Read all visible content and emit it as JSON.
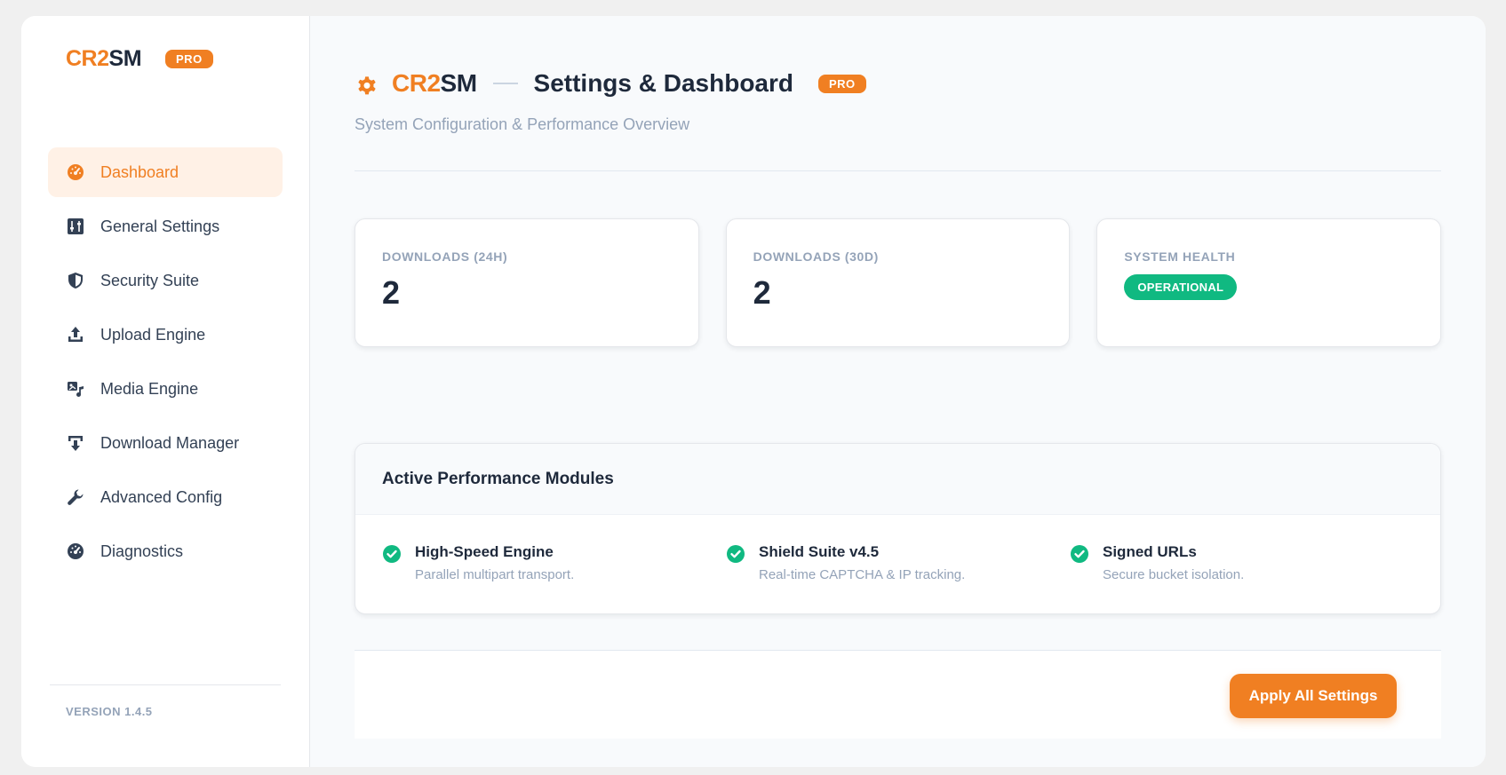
{
  "brand": {
    "name_accent": "CR2",
    "name_rest": "SM",
    "pro_label": "PRO",
    "accent_color": "#f07f22"
  },
  "sidebar": {
    "items": [
      {
        "label": "Dashboard",
        "icon": "gauge-icon",
        "active": true
      },
      {
        "label": "General Settings",
        "icon": "sliders-icon",
        "active": false
      },
      {
        "label": "Security Suite",
        "icon": "shield-icon",
        "active": false
      },
      {
        "label": "Upload Engine",
        "icon": "upload-icon",
        "active": false
      },
      {
        "label": "Media Engine",
        "icon": "media-icon",
        "active": false
      },
      {
        "label": "Download Manager",
        "icon": "download-icon",
        "active": false
      },
      {
        "label": "Advanced Config",
        "icon": "wrench-icon",
        "active": false
      },
      {
        "label": "Diagnostics",
        "icon": "gauge-icon",
        "active": false
      }
    ],
    "version": "VERSION 1.4.5"
  },
  "header": {
    "brand_accent": "CR2",
    "brand_rest": "SM",
    "title": "Settings & Dashboard",
    "pro_label": "PRO",
    "subtitle": "System Configuration & Performance Overview",
    "icon": "gear-icon"
  },
  "stats": [
    {
      "label": "DOWNLOADS (24H)",
      "value": "2"
    },
    {
      "label": "DOWNLOADS (30D)",
      "value": "2"
    },
    {
      "label": "SYSTEM HEALTH",
      "status": "OPERATIONAL",
      "status_color": "#10b981"
    }
  ],
  "modules": {
    "title": "Active Performance Modules",
    "items": [
      {
        "name": "High-Speed Engine",
        "desc": "Parallel multipart transport.",
        "icon": "check-circle-icon"
      },
      {
        "name": "Shield Suite v4.5",
        "desc": "Real-time CAPTCHA & IP tracking.",
        "icon": "check-circle-icon"
      },
      {
        "name": "Signed URLs",
        "desc": "Secure bucket isolation.",
        "icon": "check-circle-icon"
      }
    ]
  },
  "actions": {
    "apply_label": "Apply All Settings"
  }
}
